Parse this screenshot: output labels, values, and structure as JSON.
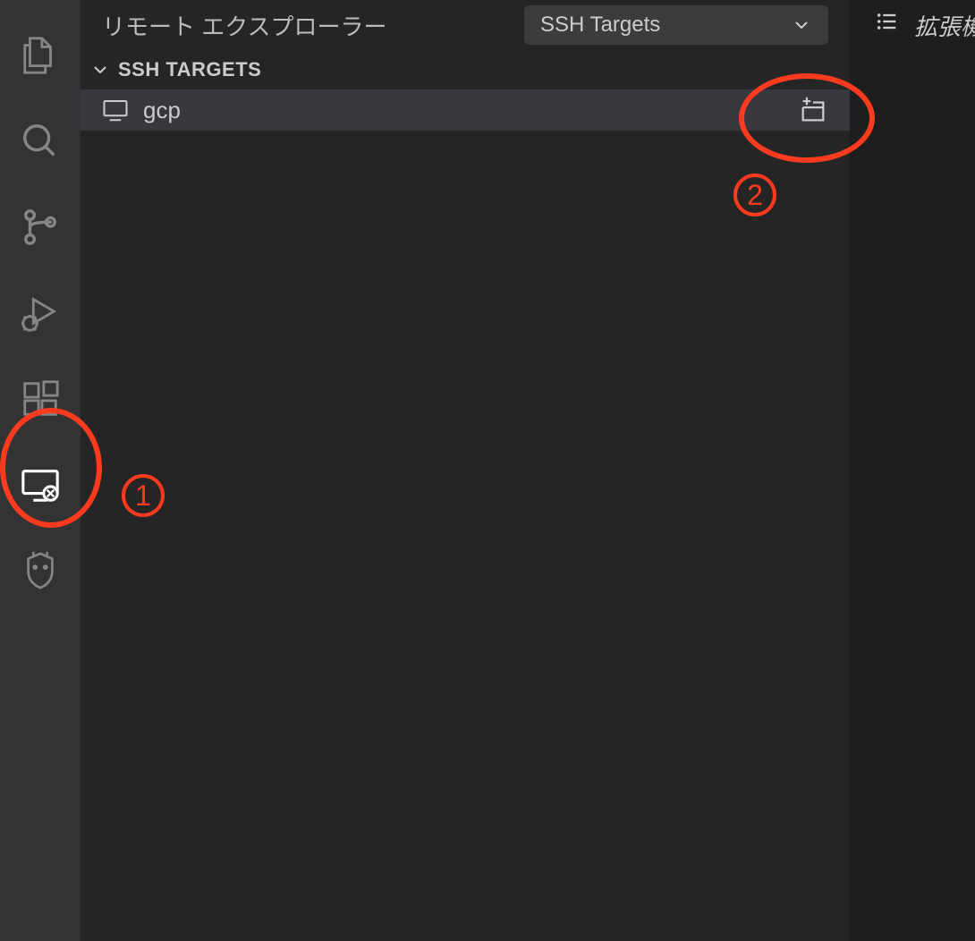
{
  "sidebar": {
    "title": "リモート エクスプローラー",
    "dropdown": {
      "selected": "SSH Targets"
    },
    "section": {
      "title": "SSH TARGETS"
    },
    "tree": {
      "items": [
        {
          "label": "gcp"
        }
      ]
    }
  },
  "rightPanel": {
    "label": "拡張機"
  },
  "annotations": {
    "label1": "1",
    "label2": "2"
  }
}
